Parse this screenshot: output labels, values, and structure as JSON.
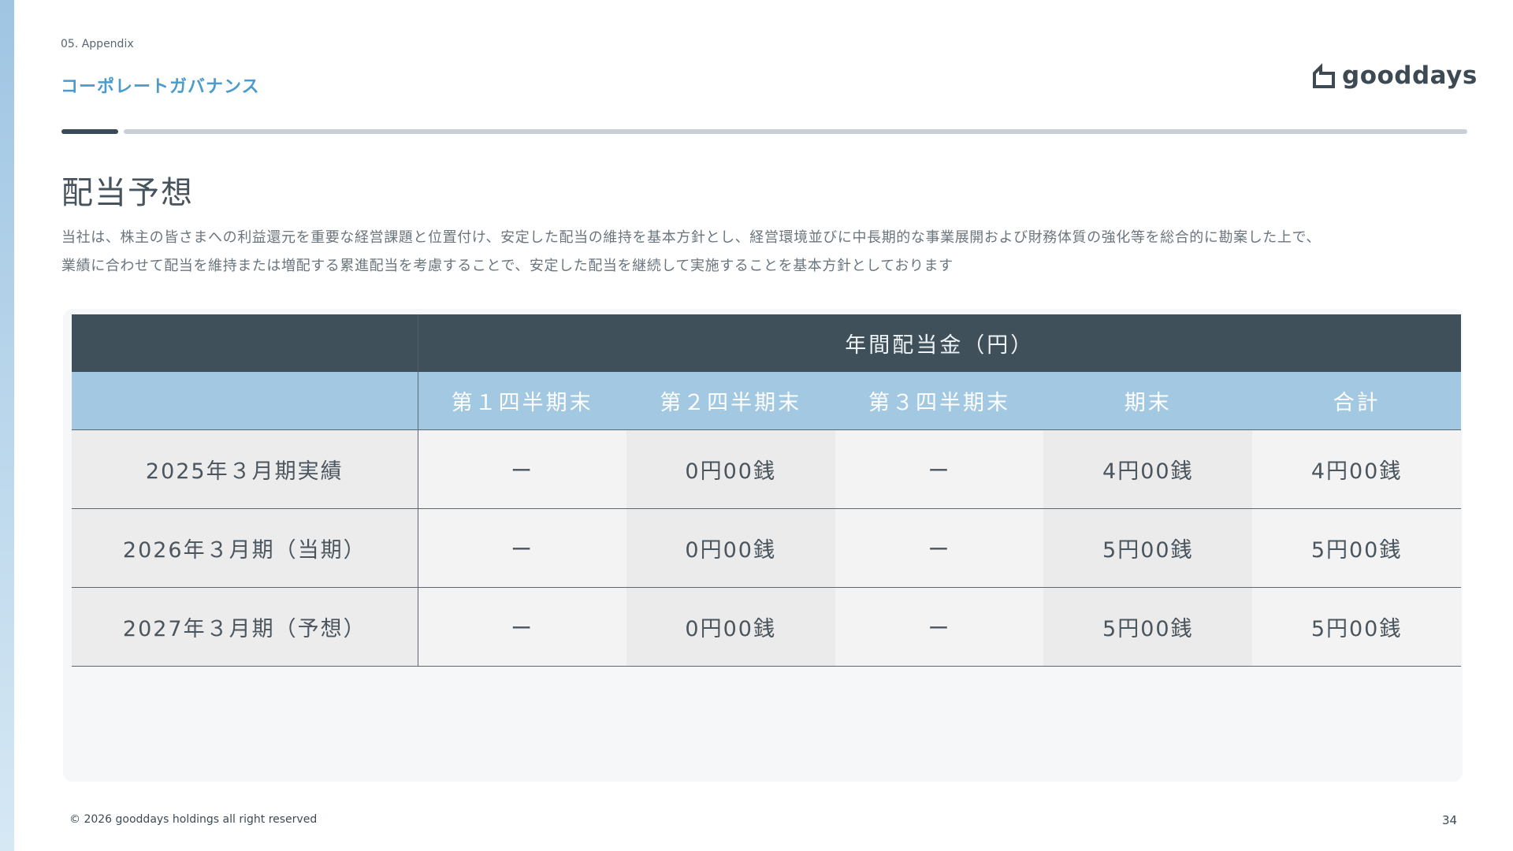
{
  "header": {
    "section_label": "05. Appendix",
    "page_subtitle": "コーポレートガバナンス",
    "logo_text": "gooddays"
  },
  "main": {
    "title": "配当予想",
    "description_lines": [
      "当社は、株主の皆さまへの利益還元を重要な経営課題と位置付け、安定した配当の維持を基本方針とし、経営環境並びに中長期的な事業展開および財務体質の強化等を総合的に勘案した上で、",
      "業績に合わせて配当を維持または増配する累進配当を考慮することで、安定した配当を継続して実施することを基本方針としております"
    ]
  },
  "table": {
    "group_header": "年間配当金（円）",
    "columns": [
      "第１四半期末",
      "第２四半期末",
      "第３四半期末",
      "期末",
      "合計"
    ],
    "rows": [
      {
        "label": "2025年３月期実績",
        "values": [
          "ー",
          "0円00銭",
          "ー",
          "4円00銭",
          "4円00銭"
        ]
      },
      {
        "label": "2026年３月期（当期）",
        "values": [
          "ー",
          "0円00銭",
          "ー",
          "5円00銭",
          "5円00銭"
        ]
      },
      {
        "label": "2027年３月期（予想）",
        "values": [
          "ー",
          "0円00銭",
          "ー",
          "5円00銭",
          "5円00銭"
        ]
      }
    ]
  },
  "footer": {
    "copyright": "© 2026 gooddays holdings all right reserved",
    "page_number": "34"
  },
  "colors": {
    "accent_blue": "#4b9bcd",
    "header_dark": "#3f505a",
    "header_light": "#a2c8e2"
  }
}
